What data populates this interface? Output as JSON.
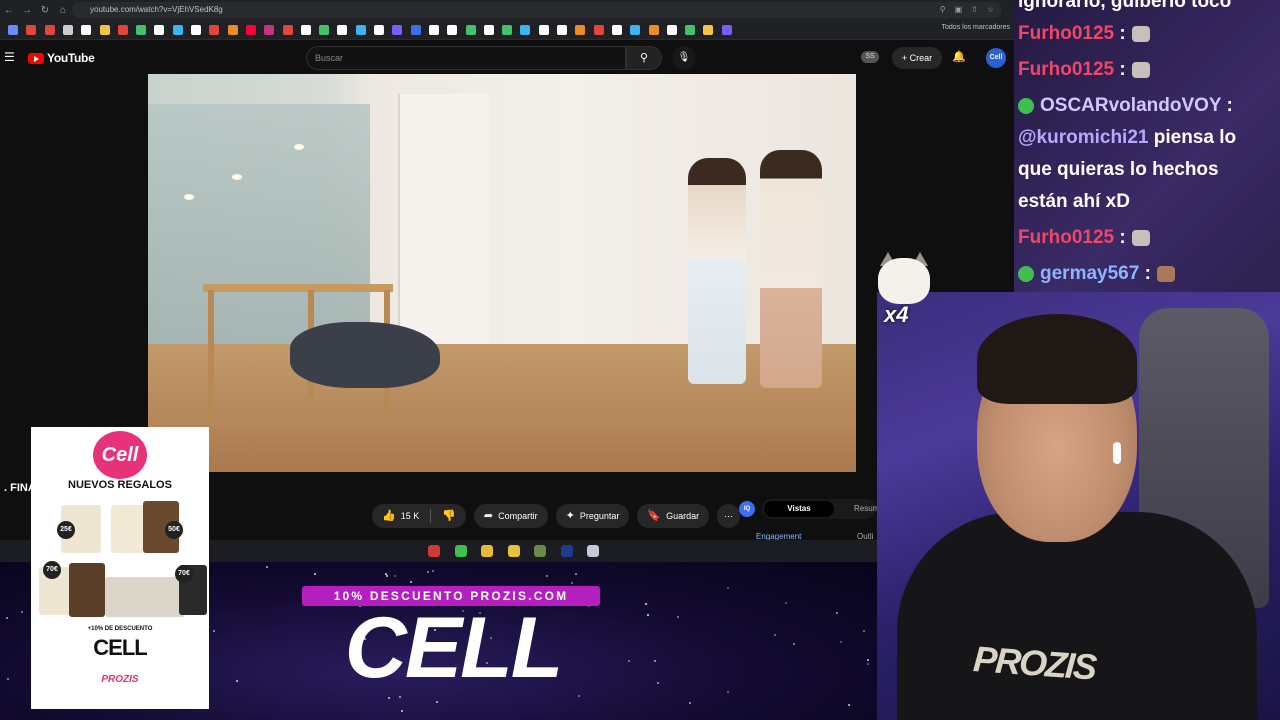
{
  "browser": {
    "url": "youtube.com/watch?v=VjEhVSedK8g",
    "bookmarks_all_label": "Todos los marcadores",
    "bookmark_colors": [
      "#6b8cff",
      "#e0463a",
      "#e0463a",
      "#cccccc",
      "#ffffff",
      "#f4c542",
      "#e0463a",
      "#42c26b",
      "#ffffff",
      "#39b6f0",
      "#ffffff",
      "#e0463a",
      "#f08a24",
      "#ff0033",
      "#c13584",
      "#e0463a",
      "#ffffff",
      "#42c26b",
      "#ffffff",
      "#39b6f0",
      "#ffffff",
      "#7b5cff",
      "#3b6ff0",
      "#ffffff",
      "#ffffff",
      "#42c26b",
      "#ffffff",
      "#42c26b",
      "#39b6f0",
      "#ffffff",
      "#ffffff",
      "#f08a24",
      "#e0463a",
      "#ffffff",
      "#39b6f0",
      "#f08a24",
      "#ffffff",
      "#42c26b",
      "#f4c542",
      "#7b5cff"
    ]
  },
  "youtube": {
    "logo_text": "YouTube",
    "search_placeholder": "Buscar",
    "ss_badge": "SS",
    "create_label": "Crear",
    "avatar_text": "Cell",
    "title_fragment": ". FINA",
    "actions": {
      "like_count": "15 K",
      "share": "Compartir",
      "ask": "Preguntar",
      "save": "Guardar"
    },
    "side_panel": {
      "badge": "IQ",
      "tab_active": "Vistas",
      "tab_other": "Resum",
      "engagement": "Engagement",
      "outline": "Outli"
    }
  },
  "taskbar": {
    "icons": [
      "record",
      "chat-app",
      "chrome",
      "files",
      "minecraft",
      "photoshop",
      "other"
    ],
    "icon_colors": [
      "#d23a3a",
      "#3fbf4f",
      "#e8b93a",
      "#e8c23a",
      "#6a8a4a",
      "#1c3c8c",
      "#c8c8d8"
    ]
  },
  "promo": {
    "tag": "10% DESCUENTO PROZIS.COM",
    "code": "CELL"
  },
  "poster": {
    "logo": "Cell",
    "heading": "NUEVOS REGALOS",
    "badges": [
      "25€",
      "50€",
      "70€",
      "70€"
    ],
    "discount": "+10% DE DESCUENTO",
    "code": "CELL",
    "brand": "PROZIS"
  },
  "chat": {
    "top_fragment": "ignorarlo, guiberlo toco",
    "messages": [
      {
        "user": "Furho0125",
        "text": ":"
      },
      {
        "user": "Furho0125",
        "text": ":"
      },
      {
        "user": "OSCARvolandoVOY",
        "text": ":"
      },
      {
        "mention": "@kuromichi21",
        "text": "piensa lo"
      },
      {
        "text": "que quieras lo hechos"
      },
      {
        "text": "están ahí xD"
      },
      {
        "user": "Furho0125",
        "text": ":"
      },
      {
        "user": "germay567",
        "text": ":"
      }
    ]
  },
  "sticker": {
    "multiplier": "x4"
  },
  "webcam": {
    "shirt_text": "PROZIS"
  }
}
